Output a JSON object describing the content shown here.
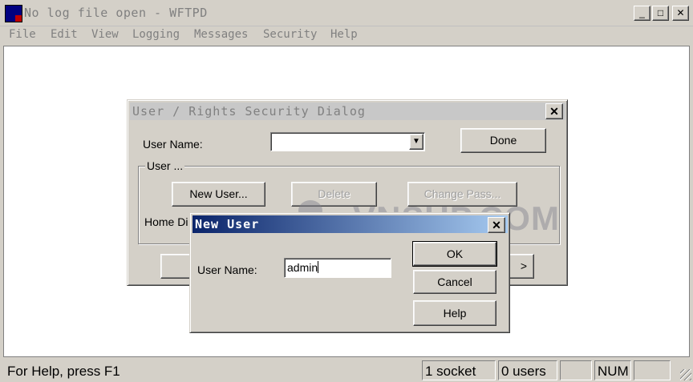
{
  "window": {
    "title": "No log file open - WFTPD"
  },
  "menu": [
    "File",
    "Edit",
    "View",
    "Logging",
    "Messages",
    "Security",
    "Help"
  ],
  "security_dialog": {
    "title": "User / Rights Security Dialog",
    "user_name_label": "User Name:",
    "user_name_value": "",
    "done_label": "Done",
    "group_label": "User ...",
    "new_user_label": "New User...",
    "delete_label": "Delete",
    "change_pass_label": "Change Pass...",
    "home_dir_label": "Home Di",
    "partial_right_label": ">"
  },
  "new_user_dialog": {
    "title": "New User",
    "user_name_label": "User Name:",
    "user_name_value": "admin",
    "ok_label": "OK",
    "cancel_label": "Cancel",
    "help_label": "Help"
  },
  "watermark": "VNSUP.COM",
  "status": {
    "help_text": "For Help, press F1",
    "sockets": "1 socket",
    "users": "0 users",
    "num": "NUM"
  },
  "icons": [
    "app-icon",
    "minimize-icon",
    "maximize-icon",
    "close-icon",
    "dropdown-arrow-icon",
    "size-grip-icon"
  ]
}
